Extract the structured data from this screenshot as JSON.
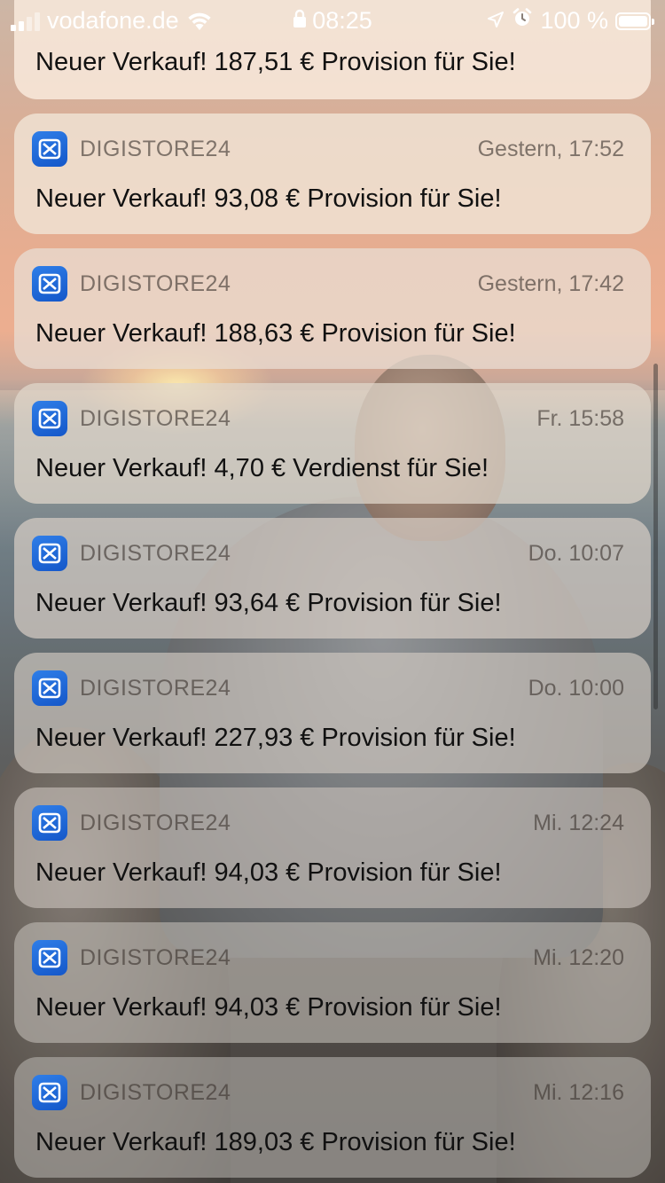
{
  "status_bar": {
    "carrier": "vodafone.de",
    "time": "08:25",
    "battery": "100 %",
    "battery_level": 1.0,
    "icons": [
      "signal-icon",
      "wifi-icon",
      "lock-icon",
      "location-icon",
      "alarm-icon",
      "battery-icon"
    ]
  },
  "colors": {
    "app_icon": "#1f6ad8",
    "card_top": "#f3e2d0",
    "card_bottom": "#b9b4ae"
  },
  "notifications": [
    {
      "app": "",
      "time": "",
      "message": "Neuer Verkauf! 187,51 € Provision für Sie!",
      "partial": true
    },
    {
      "app": "DIGISTORE24",
      "time": "Gestern, 17:52",
      "message": "Neuer Verkauf! 93,08 € Provision für Sie!"
    },
    {
      "app": "DIGISTORE24",
      "time": "Gestern, 17:42",
      "message": "Neuer Verkauf! 188,63 € Provision für Sie!"
    },
    {
      "app": "DIGISTORE24",
      "time": "Fr. 15:58",
      "message": "Neuer Verkauf! 4,70 € Verdienst für Sie!"
    },
    {
      "app": "DIGISTORE24",
      "time": "Do. 10:07",
      "message": "Neuer Verkauf! 93,64 € Provision für Sie!"
    },
    {
      "app": "DIGISTORE24",
      "time": "Do. 10:00",
      "message": "Neuer Verkauf! 227,93 € Provision für Sie!"
    },
    {
      "app": "DIGISTORE24",
      "time": "Mi. 12:24",
      "message": "Neuer Verkauf! 94,03 € Provision für Sie!"
    },
    {
      "app": "DIGISTORE24",
      "time": "Mi. 12:20",
      "message": "Neuer Verkauf! 94,03 € Provision für Sie!"
    },
    {
      "app": "DIGISTORE24",
      "time": "Mi. 12:16",
      "message": "Neuer Verkauf! 189,03 € Provision für Sie!"
    }
  ]
}
